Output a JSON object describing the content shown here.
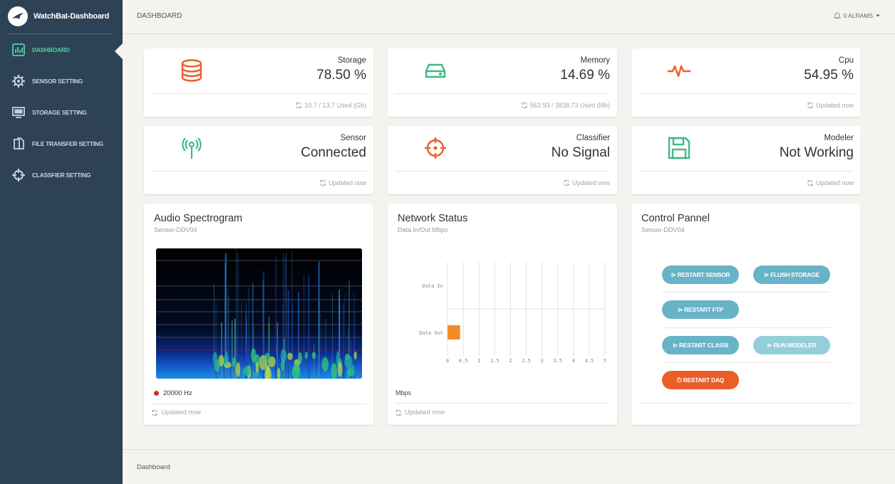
{
  "app": {
    "title": "WatchBat-Dashboard"
  },
  "sidebar": {
    "items": [
      {
        "label": "DASHBOARD",
        "icon": "bar-chart-icon",
        "active": true
      },
      {
        "label": "SENSOR SETTING",
        "icon": "gear-icon"
      },
      {
        "label": "STORAGE SETTING",
        "icon": "monitor-icon"
      },
      {
        "label": "FILE TRANSFER SETTING",
        "icon": "files-icon"
      },
      {
        "label": "CLASSFIER SETTING",
        "icon": "crosshair-icon"
      }
    ]
  },
  "topbar": {
    "title": "DASHBOARD",
    "alarms": "0 ALRAMS"
  },
  "stats": [
    {
      "label": "Storage",
      "value": "78.50 %",
      "footer": "10.7 / 13.7 Used (Gb)",
      "icon": "database-icon",
      "color": "#eb5e28"
    },
    {
      "label": "Memory",
      "value": "14.69 %",
      "footer": "563.93 / 3838.73 Used (Mb)",
      "icon": "hdd-icon",
      "color": "#41b883"
    },
    {
      "label": "Cpu",
      "value": "54.95 %",
      "footer": "Updated now",
      "icon": "pulse-icon",
      "color": "#eb5e28"
    },
    {
      "label": "Sensor",
      "value": "Connected",
      "footer": "Updated now",
      "icon": "antenna-icon",
      "color": "#41b883"
    },
    {
      "label": "Classifier",
      "value": "No Signal",
      "footer": "Updated now",
      "icon": "target-icon",
      "color": "#eb5e28"
    },
    {
      "label": "Modeler",
      "value": "Not Working",
      "footer": "Updated now",
      "icon": "save-icon",
      "color": "#41b883"
    }
  ],
  "spectrogram": {
    "title": "Audio Spectrogram",
    "subtitle": "Sensor-DDV04",
    "legend": "20000 Hz",
    "footer": "Updated now"
  },
  "network": {
    "title": "Network Status",
    "subtitle": "Data In/Out Mbps",
    "unit_label": "Mbps",
    "footer": "Updated now"
  },
  "chart_data": {
    "type": "bar",
    "orientation": "horizontal",
    "categories": [
      "Data In",
      "Data Out"
    ],
    "values": [
      0,
      0.4
    ],
    "xlim": [
      0,
      5
    ],
    "xticks": [
      "0",
      "0.5",
      "1",
      "1.5",
      "2",
      "2.5",
      "3",
      "3.5",
      "4",
      "4.5",
      "5"
    ],
    "bar_color": "#f28c28",
    "grid": true
  },
  "control": {
    "title": "Control Pannel",
    "subtitle": "Sensor-DDV04",
    "buttons": {
      "restart_sensor": "⊳ RESTART SENSOR",
      "flush_storage": "⊳ FLUSH STORAGE",
      "restart_ftp": "⊳ RESTART FTP",
      "restart_classi": "⊳ RESTART CLASSI",
      "run_modeler": "⊳ RUN MODELER",
      "restart_daq": "⏻ RESTART DAQ"
    }
  },
  "footer": {
    "breadcrumb": "Dashboard"
  }
}
